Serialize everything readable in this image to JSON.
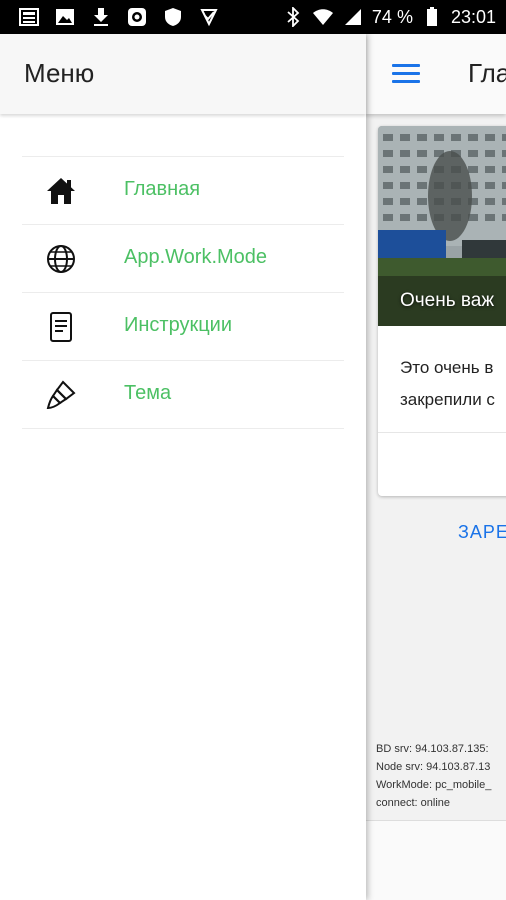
{
  "status_bar": {
    "battery": "74 %",
    "time": "23:01",
    "icons": [
      "newspaper-icon",
      "image-icon",
      "download-icon",
      "android-icon",
      "shield-icon",
      "check-icon"
    ],
    "right_icons": [
      "bluetooth-icon",
      "wifi-icon",
      "signal-icon",
      "battery-icon"
    ]
  },
  "drawer": {
    "title": "Меню",
    "items": [
      {
        "label": "Главная",
        "icon": "home-icon"
      },
      {
        "label": "App.Work.Mode",
        "icon": "globe-icon"
      },
      {
        "label": "Инструкции",
        "icon": "document-icon"
      },
      {
        "label": "Тема",
        "icon": "paint-brush-icon"
      }
    ]
  },
  "main": {
    "title": "Гла",
    "card": {
      "image_title": "Очень важ",
      "text_line1": "Это очень в",
      "text_line2": "закрепили с"
    },
    "pin_button": "ЗАРЕ",
    "info": {
      "bd_srv": "BD srv: 94.103.87.135:",
      "node_srv": "Node srv: 94.103.87.13",
      "work_mode": "WorkMode: pc_mobile_",
      "connect": "connect: online"
    }
  },
  "colors": {
    "accent_green": "#4cc064",
    "accent_blue": "#1a73e8"
  }
}
